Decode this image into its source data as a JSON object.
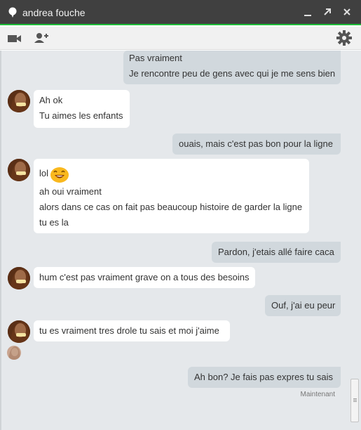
{
  "window": {
    "title": "andrea fouche",
    "accent_color": "#1fbe3a",
    "icons": [
      "status-bubble-icon",
      "minimize-icon",
      "popout-icon",
      "close-icon"
    ]
  },
  "toolbar": {
    "icons": [
      "video-call-icon",
      "add-person-icon",
      "gear-icon"
    ]
  },
  "messages": [
    {
      "direction": "out",
      "lines": [
        "Pas vraiment",
        "Je rencontre peu de gens avec qui je me sens bien"
      ]
    },
    {
      "direction": "in",
      "lines": [
        "Ah ok",
        "Tu aimes les enfants"
      ]
    },
    {
      "direction": "out",
      "lines": [
        "ouais, mais c'est pas bon pour la ligne"
      ]
    },
    {
      "direction": "in",
      "lines": [
        "lol",
        "ah oui vraiment",
        "alors dans ce cas on fait pas beaucoup histoire de garder la ligne",
        "tu es la"
      ],
      "emoji": "grinning-emoji"
    },
    {
      "direction": "out",
      "lines": [
        "Pardon, j'etais allé faire caca"
      ]
    },
    {
      "direction": "in",
      "lines": [
        "hum c'est pas vraiment grave on a tous des besoins"
      ]
    },
    {
      "direction": "out",
      "lines": [
        "Ouf, j'ai eu peur"
      ]
    },
    {
      "direction": "in",
      "lines": [
        "tu es vraiment tres drole tu sais et  moi j'aime"
      ]
    },
    {
      "direction": "out",
      "lines": [
        "Ah bon? Je fais pas expres tu sais"
      ]
    }
  ],
  "timestamp": "Maintenant",
  "colors": {
    "outgoing_bubble": "#d1d8dd",
    "incoming_bubble": "#ffffff",
    "chat_background": "#e5e8eb"
  }
}
